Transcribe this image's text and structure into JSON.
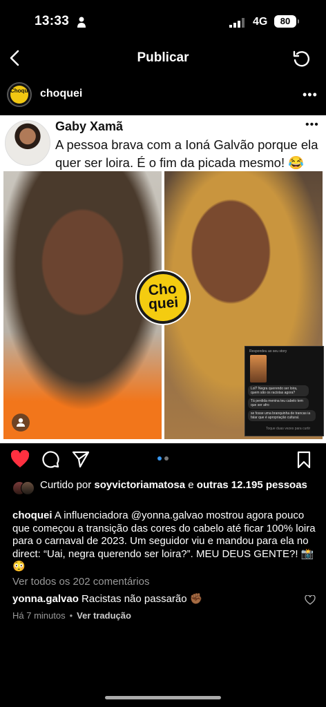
{
  "status_bar": {
    "time": "13:33",
    "network": "4G",
    "battery": "80"
  },
  "nav": {
    "title": "Publicar"
  },
  "post": {
    "username": "choquei",
    "more": "•••",
    "avatar_logo": "Choquei"
  },
  "tweet": {
    "name": "Gaby Xamã",
    "more": "•••",
    "text": "A pessoa brava com a Ioná Galvão porque ela quer ser loira. É o fim da picada mesmo! 😂",
    "logo_line1": "Cho",
    "logo_line2": "quei",
    "dm": {
      "header": "Respondeu ao seu story",
      "messages": [
        "Lol? Negra querendo ser loira, quem são os racistas agora?",
        "Tá perdida menina teu cabelo tem que ser afro",
        "se fosse uma branquinha de trancas ia falar que é apropriação cultural."
      ],
      "footer": "Toque duas vezes para curtir"
    }
  },
  "likes": {
    "prefix": "Curtido por ",
    "user": "soyvictoriamatosa",
    "middle": " e ",
    "others": "outras 12.195",
    "suffix": " pessoas"
  },
  "caption": {
    "user": "choquei",
    "text": "A influenciadora @yonna.galvao mostrou agora pouco que começou a transição das cores do cabelo até ficar 100% loira para o carnaval de 2023. Um seguidor viu e mandou para ela no direct: “Uai, negra querendo ser loira?”. MEU DEUS GENTE?! 📸😳"
  },
  "view_all_comments": "Ver todos os 202 comentários",
  "comment": {
    "user": "yonna.galvao",
    "text": "Racistas não passarão ✊🏾"
  },
  "meta": {
    "time_ago": "Há 7 minutos",
    "sep": "•",
    "translate": "Ver tradução"
  },
  "colors": {
    "like_red": "#ff3040",
    "carousel_active": "#3897f0",
    "choquei_yellow": "#f4cc10"
  },
  "icons": [
    "person-icon",
    "signal-icon",
    "back-icon",
    "refresh-icon",
    "heart-icon",
    "comment-icon",
    "share-icon",
    "bookmark-icon",
    "profile-icon"
  ]
}
